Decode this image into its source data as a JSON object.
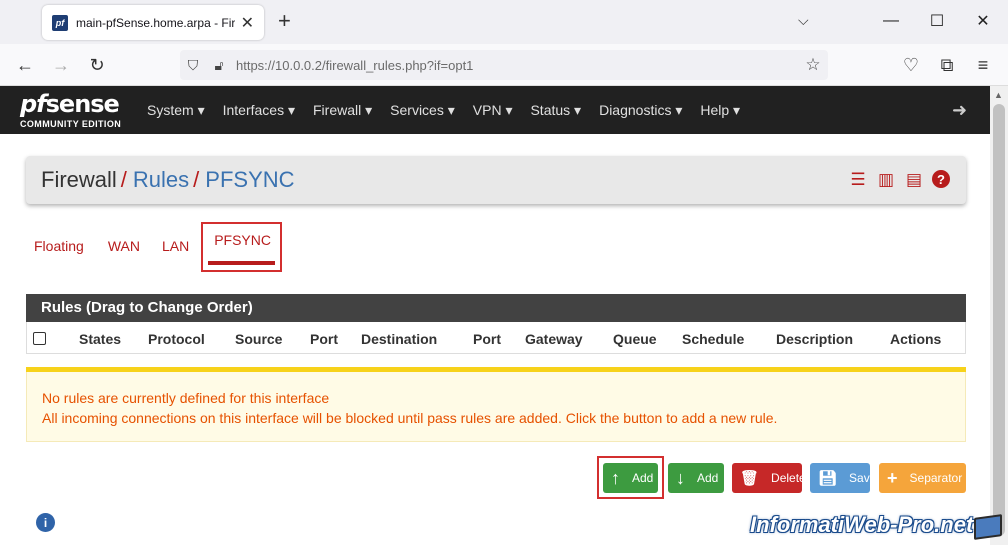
{
  "browser": {
    "tab_title": "main-pfSense.home.arpa - Firefox",
    "url_host": "https://10.0.0.2",
    "url_path": "/firewall_rules.php?if=opt1"
  },
  "brand": {
    "logo_pf": "pf",
    "logo_sense": "sense",
    "edition": "COMMUNITY EDITION"
  },
  "menu": [
    "System ▾",
    "Interfaces ▾",
    "Firewall ▾",
    "Services ▾",
    "VPN ▾",
    "Status ▾",
    "Diagnostics ▾",
    "Help ▾"
  ],
  "breadcrumb": {
    "root": "Firewall",
    "sep": "/",
    "section": "Rules",
    "current": "PFSYNC"
  },
  "interface_tabs": [
    "Floating",
    "WAN",
    "LAN",
    "PFSYNC"
  ],
  "active_tab": "PFSYNC",
  "rules_panel": {
    "title": "Rules (Drag to Change Order)",
    "columns": [
      "States",
      "Protocol",
      "Source",
      "Port",
      "Destination",
      "Port",
      "Gateway",
      "Queue",
      "Schedule",
      "Description",
      "Actions"
    ]
  },
  "alert": {
    "line1": "No rules are currently defined for this interface",
    "line2": "All incoming connections on this interface will be blocked until pass rules are added. Click the button to add a new rule."
  },
  "buttons": {
    "add_top": "Add",
    "add_bottom": "Add",
    "delete": "Delete",
    "save": "Save",
    "separator": "Separator"
  },
  "watermark": "InformatiWeb-Pro.net",
  "colors": {
    "accent_red": "#b71c1c",
    "link_blue": "#3a72b0",
    "btn_green": "#3d9b40",
    "btn_red": "#c62828",
    "btn_blue": "#5b9bd5",
    "btn_orange": "#f5a53b",
    "alert_text": "#e65100"
  }
}
